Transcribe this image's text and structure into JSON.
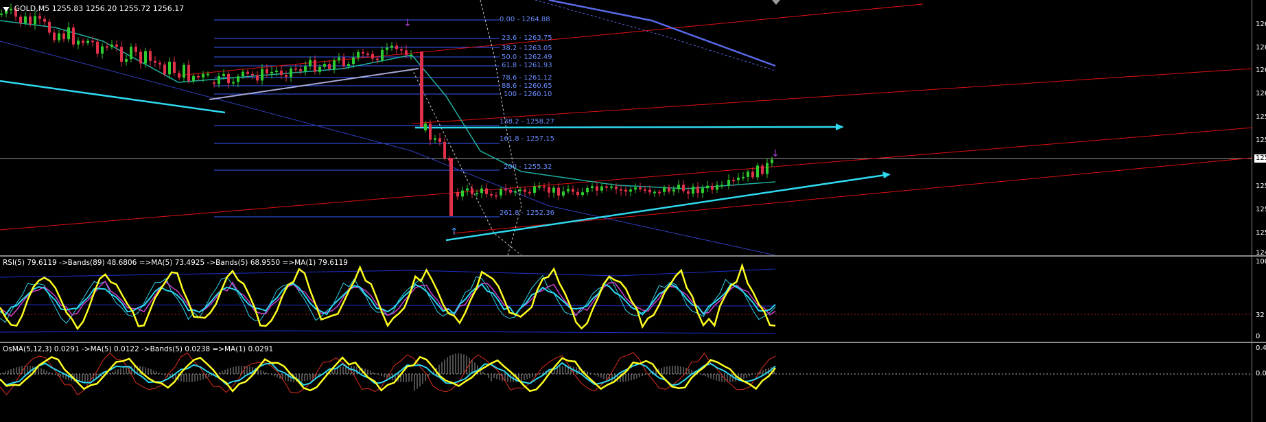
{
  "chart_window": {
    "symbol_header": "GOLD,M5",
    "ohlc_header": "1255.83 1256.20 1255.72 1256.17",
    "current_price_label": "125",
    "price_axis_labels": [
      "126",
      "126",
      "126",
      "126",
      "125",
      "125",
      "125",
      "125",
      "125",
      "125",
      "125",
      "124"
    ],
    "fibonacci_levels": [
      {
        "label": "0.00 - 1264.88"
      },
      {
        "label": "23.6 - 1263.75"
      },
      {
        "label": "38.2 - 1263.05"
      },
      {
        "label": "50.0 - 1262.49"
      },
      {
        "label": "61.8 - 1261.93"
      },
      {
        "label": "78.6 - 1261.12"
      },
      {
        "label": "88.6 - 1260.65"
      },
      {
        "label": "100 - 1260.10"
      },
      {
        "label": "138.2 - 1258.27"
      },
      {
        "label": "161.8 - 1257.15"
      },
      {
        "label": "200 - 1255.32"
      },
      {
        "label": "261.8 - 1252.36"
      }
    ],
    "colors": {
      "background": "#000000",
      "bull_candle": "#2ecc2e",
      "bear_candle": "#e0304a",
      "trendline": "#2fd9f0",
      "channel": "#e01010",
      "fib": "#3a5cff",
      "ma_teal": "#20b0a0",
      "down_channel": "#5a6ae8"
    }
  },
  "rsi_panel": {
    "title": "RSI(5) 79.6119  ->Bands(89) 48.6806  =>MA(5) 73.4925  ->Bands(5) 68.9550  =>MA(1) 79.6119",
    "axis_labels": [
      "100",
      "32",
      "0"
    ]
  },
  "osma_panel": {
    "title": "OsMA(5,12,3) 0.0291  ->MA(5) 0.0122  ->Bands(5) 0.0238  =>MA(1) 0.0291",
    "axis_labels": [
      "0.4",
      "0.0"
    ]
  }
}
